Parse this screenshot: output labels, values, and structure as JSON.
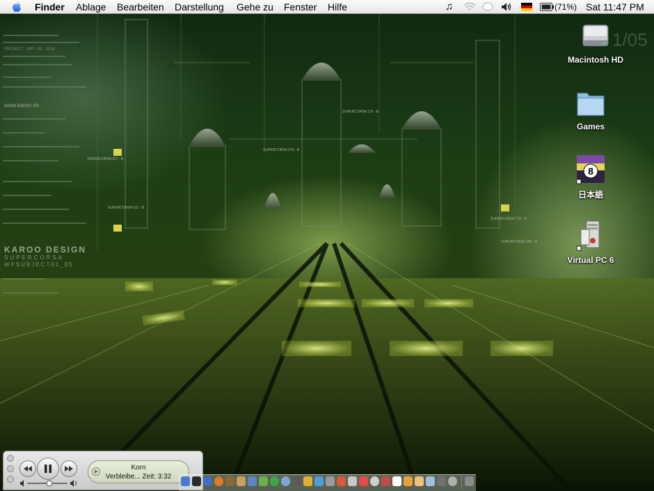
{
  "menubar": {
    "app_name": "Finder",
    "menus": [
      "Ablage",
      "Bearbeiten",
      "Darstellung",
      "Gehe zu",
      "Fenster",
      "Hilfe"
    ],
    "battery": "(71%)",
    "clock": "Sat 11:47 PM"
  },
  "desktop": {
    "icons": [
      {
        "label": "Macintosh HD",
        "icon": "hard-drive-icon"
      },
      {
        "label": "Games",
        "icon": "folder-icon"
      },
      {
        "label": "日本語",
        "icon": "language-alias-icon"
      },
      {
        "label": "Virtual PC 6",
        "icon": "virtual-pc-icon"
      }
    ],
    "wallpaper_text": {
      "brand": "KAROO DESIGN",
      "sub1": "SUPERCORSA",
      "sub2": "WPSUBJECT01_05",
      "url": "www.karoo.de",
      "project": "PROJECT : WP / 05 - 2018",
      "corner": "1/05",
      "tags": [
        "SUPERCORSA 227 - B",
        "SUPERCORSA 175 - B",
        "SUPERCORSA 176 - B",
        "SUPERCORSA 511 - B",
        "SUPERCORSA 731 - B",
        "SUPERCORSA 186 - B"
      ]
    }
  },
  "player": {
    "artist": "Korn",
    "status_line": "Verbleibe...  Zeit: 3:32"
  },
  "colors": {
    "dock_accent": "#4a7bd0",
    "wallpaper_glow": "#cfe87a"
  }
}
